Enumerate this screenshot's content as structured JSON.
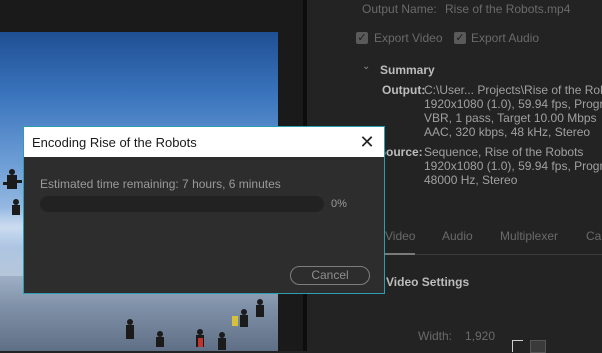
{
  "encoding_dialog": {
    "title": "Encoding Rise of the Robots",
    "close_glyph": "✕",
    "estimated_time": "Estimated time remaining: 7 hours, 6 minutes",
    "progress_percent_label": "0%",
    "progress_value": 0,
    "cancel_label": "Cancel",
    "accent_color": "#2f9db0"
  },
  "export_settings": {
    "output_name_label": "Output Name:",
    "output_name_value": "Rise of the Robots.mp4",
    "export_video_label": "Export Video",
    "export_audio_label": "Export Audio",
    "summary": {
      "header": "Summary",
      "output_label": "Output:",
      "output_lines": [
        "C:\\User... Projects\\Rise of the Robots",
        "1920x1080 (1.0), 59.94 fps, Progressi",
        "VBR, 1 pass, Target 10.00 Mbps",
        "AAC, 320 kbps, 48 kHz, Stereo"
      ],
      "source_label": "Source:",
      "source_lines": [
        "Sequence, Rise of the Robots",
        "1920x1080 (1.0), 59.94 fps, Progressi",
        "48000 Hz, Stereo"
      ]
    },
    "tabs": [
      "Video",
      "Audio",
      "Multiplexer",
      "Cap"
    ],
    "video_settings_header": "Video Settings",
    "width_label": "Width:",
    "width_value": "1,920"
  }
}
